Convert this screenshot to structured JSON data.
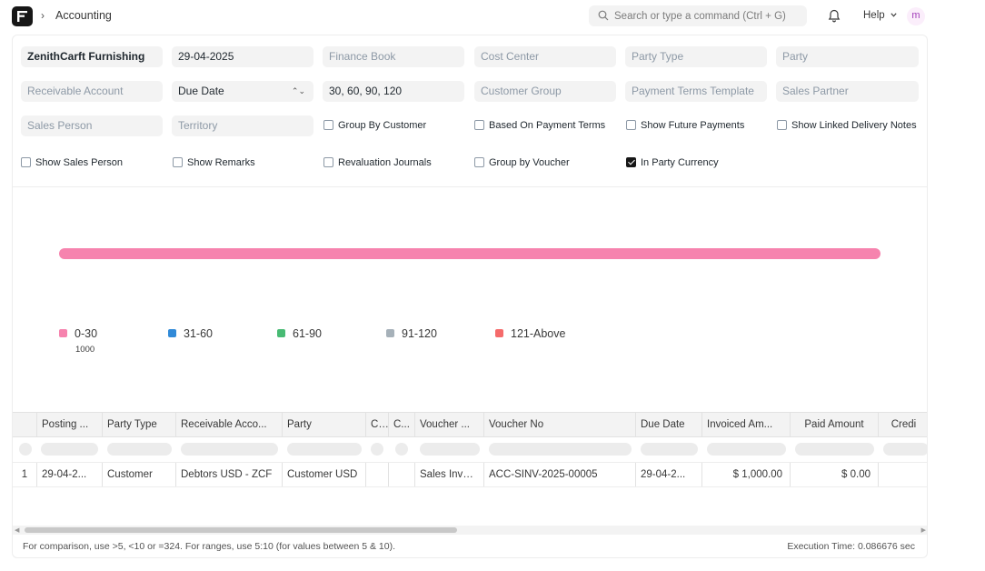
{
  "navbar": {
    "breadcrumb_sep": "›",
    "breadcrumb": "Accounting",
    "search_placeholder": "Search or type a command (Ctrl + G)",
    "help_label": "Help",
    "avatar_initial": "m"
  },
  "filters": {
    "company": "ZenithCarft Furnishing",
    "date": "29-04-2025",
    "finance_book": "Finance Book",
    "cost_center": "Cost Center",
    "party_type": "Party Type",
    "party": "Party",
    "receivable_account": "Receivable Account",
    "ageing_based_on": "Due Date",
    "ranges": "30, 60, 90, 120",
    "customer_group": "Customer Group",
    "payment_terms_template": "Payment Terms Template",
    "sales_partner": "Sales Partner",
    "sales_person": "Sales Person",
    "territory": "Territory",
    "checkboxes": [
      {
        "label": "Group By Customer",
        "checked": false
      },
      {
        "label": "Based On Payment Terms",
        "checked": false
      },
      {
        "label": "Show Future Payments",
        "checked": false
      },
      {
        "label": "Show Linked Delivery Notes",
        "checked": false
      },
      {
        "label": "Show Sales Person",
        "checked": false
      },
      {
        "label": "Show Remarks",
        "checked": false
      },
      {
        "label": "Revaluation Journals",
        "checked": false
      },
      {
        "label": "Group by Voucher",
        "checked": false
      },
      {
        "label": "In Party Currency",
        "checked": true
      }
    ]
  },
  "chart_data": {
    "type": "bar",
    "orientation": "horizontal",
    "stacked": true,
    "series": [
      {
        "name": "0-30",
        "values": [
          1000
        ],
        "color": "#f683ae"
      },
      {
        "name": "31-60",
        "values": [
          0
        ],
        "color": "#318ad8"
      },
      {
        "name": "61-90",
        "values": [
          0
        ],
        "color": "#48bb74"
      },
      {
        "name": "91-120",
        "values": [
          0
        ],
        "color": "#a6b1b9"
      },
      {
        "name": "121-Above",
        "values": [
          0
        ],
        "color": "#f56b6b"
      }
    ],
    "legend_position": "bottom-left",
    "grid": false,
    "tooltip_value": "1000"
  },
  "table": {
    "columns": [
      "",
      "Posting ...",
      "Party Type",
      "Receivable Acco...",
      "Party",
      "C...",
      "C...",
      "Voucher ...",
      "Voucher No",
      "Due Date",
      "Invoiced Am...",
      "Paid Amount",
      "Credi"
    ],
    "rows": [
      [
        "1",
        "29-04-2...",
        "Customer",
        "Debtors USD - ZCF",
        "Customer USD",
        "",
        "",
        "Sales Invoi...",
        "ACC-SINV-2025-00005",
        "29-04-2...",
        "$ 1,000.00",
        "$ 0.00",
        ""
      ]
    ]
  },
  "footer": {
    "hint": "For comparison, use >5, <10 or =324. For ranges, use 5:10 (for values between 5 & 10).",
    "execution_time": "Execution Time: 0.086676 sec"
  }
}
